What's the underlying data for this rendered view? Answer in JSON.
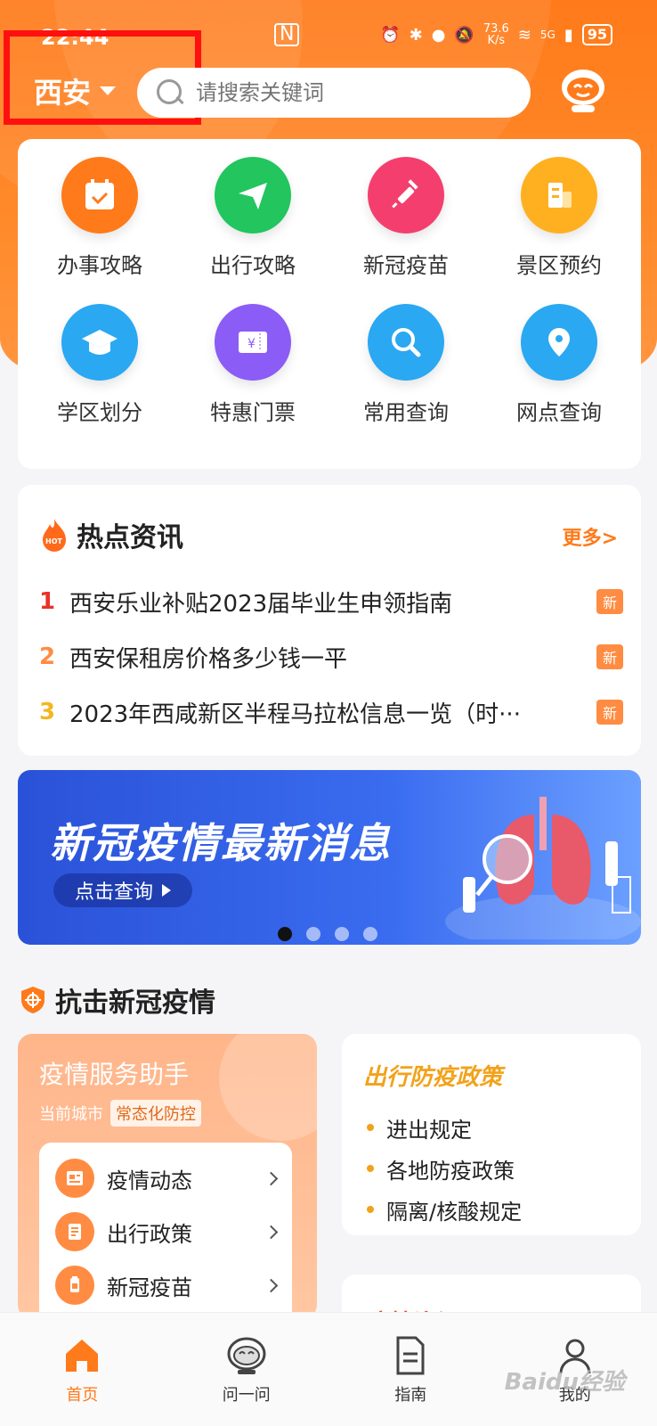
{
  "status_bar": {
    "time": "22:44",
    "net_speed": "73.6",
    "net_unit": "K/s",
    "signal": "5G",
    "battery": "95"
  },
  "header": {
    "city": "西安",
    "search_placeholder": "请搜索关键词"
  },
  "quick_grid": [
    {
      "label": "办事攻略",
      "icon": "calendar-check-icon",
      "color": "#ff7a1a"
    },
    {
      "label": "出行攻略",
      "icon": "paper-plane-icon",
      "color": "#22c55e"
    },
    {
      "label": "新冠疫苗",
      "icon": "syringe-icon",
      "color": "#f43f6e"
    },
    {
      "label": "景区预约",
      "icon": "building-icon",
      "color": "#ffb020"
    },
    {
      "label": "学区划分",
      "icon": "graduation-cap-icon",
      "color": "#2aa8f2"
    },
    {
      "label": "特惠门票",
      "icon": "ticket-icon",
      "color": "#8b5cf6"
    },
    {
      "label": "常用查询",
      "icon": "magnifier-icon",
      "color": "#2aa8f2"
    },
    {
      "label": "网点查询",
      "icon": "location-pin-icon",
      "color": "#2aa8f2"
    }
  ],
  "hot_news": {
    "title": "热点资讯",
    "more": "更多>",
    "items": [
      {
        "num": "1",
        "num_color": "#e8332a",
        "text": "西安乐业补贴2023届毕业生申领指南",
        "badge": "新"
      },
      {
        "num": "2",
        "num_color": "#ff8c42",
        "text": "西安保租房价格多少钱一平",
        "badge": "新"
      },
      {
        "num": "3",
        "num_color": "#f5b623",
        "text": "2023年西咸新区半程马拉松信息一览（时···",
        "badge": "新"
      }
    ]
  },
  "banner": {
    "title": "新冠疫情最新消息",
    "button": "点击查询",
    "slide_index": 1,
    "slide_count": 4
  },
  "fight_covid": {
    "title": "抗击新冠疫情",
    "assistant": {
      "title": "疫情服务助手",
      "city_label": "当前城市",
      "city_tag": "常态化防控",
      "items": [
        {
          "label": "疫情动态",
          "icon": "news-icon"
        },
        {
          "label": "出行政策",
          "icon": "notebook-icon"
        },
        {
          "label": "新冠疫苗",
          "icon": "vaccine-icon"
        }
      ]
    },
    "policy": {
      "title": "出行防疫政策",
      "items": [
        "进出规定",
        "各地防疫政策",
        "隔离/核酸规定"
      ]
    },
    "info": {
      "title": "疫情资讯"
    }
  },
  "bottom_nav": [
    {
      "label": "首页",
      "icon": "home-icon",
      "active": true
    },
    {
      "label": "问一问",
      "icon": "robot-icon",
      "active": false
    },
    {
      "label": "指南",
      "icon": "document-icon",
      "active": false
    },
    {
      "label": "我的",
      "icon": "user-icon",
      "active": false
    }
  ],
  "watermark": "Baidu经验"
}
